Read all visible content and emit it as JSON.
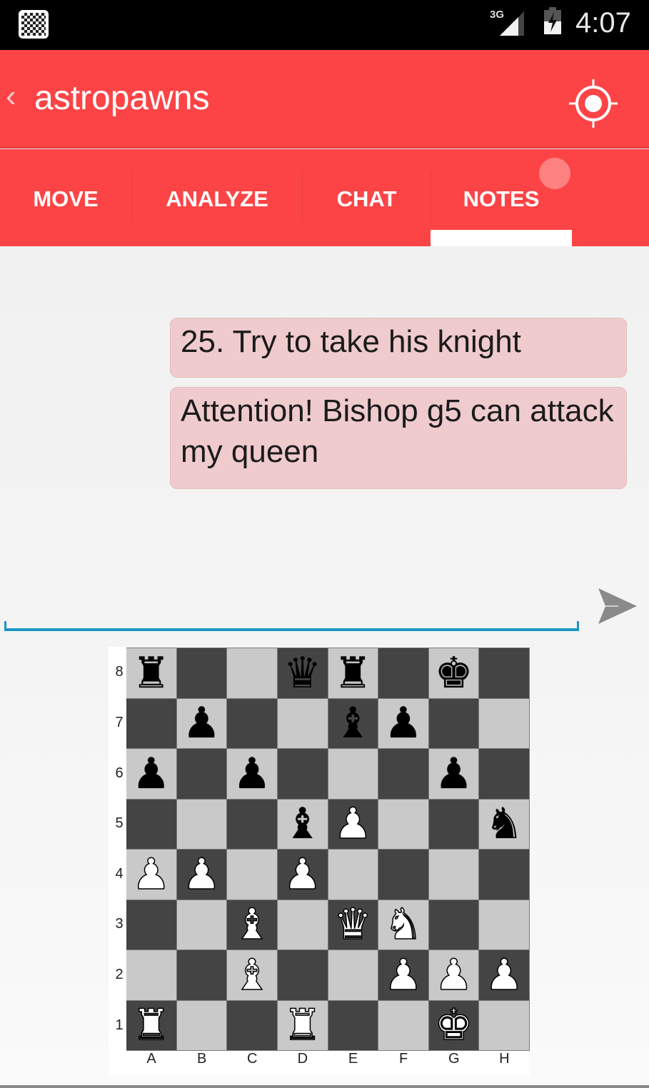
{
  "status_bar": {
    "app_icon": "chessboard-icon",
    "network": "3G",
    "signal_icon": "signal-icon",
    "battery_icon": "battery-charging-icon",
    "time": "4:07"
  },
  "app_bar": {
    "back_icon": "‹",
    "title": "astropawns",
    "action_icon": "target-icon",
    "color": "#fc4446"
  },
  "tabs": [
    {
      "label": "MOVE",
      "active": false
    },
    {
      "label": "ANALYZE",
      "active": false
    },
    {
      "label": "CHAT",
      "active": false
    },
    {
      "label": "NOTES",
      "active": true,
      "badge": true
    }
  ],
  "notes": [
    {
      "text": "25. Try to take his knight"
    },
    {
      "text": "Attention! Bishop g5 can attack my queen"
    }
  ],
  "note_input": {
    "value": "",
    "placeholder": "",
    "send_icon": "send-icon"
  },
  "board": {
    "ranks": [
      "8",
      "7",
      "6",
      "5",
      "4",
      "3",
      "2",
      "1"
    ],
    "files": [
      "A",
      "B",
      "C",
      "D",
      "E",
      "F",
      "G",
      "H"
    ],
    "rows": [
      [
        "r",
        "",
        "",
        "q",
        "r",
        "",
        "k",
        ""
      ],
      [
        "",
        "p",
        "",
        "",
        "b",
        "p",
        "",
        ""
      ],
      [
        "p",
        "",
        "p",
        "",
        "",
        "",
        "p",
        ""
      ],
      [
        "",
        "",
        "",
        "b",
        "P",
        "",
        "",
        "n"
      ],
      [
        "P",
        "P",
        "",
        "P",
        "",
        "",
        "",
        ""
      ],
      [
        "",
        "",
        "B",
        "",
        "Q",
        "N",
        "",
        ""
      ],
      [
        "",
        "",
        "B",
        "",
        "",
        "P",
        "P",
        "P"
      ],
      [
        "R",
        "",
        "",
        "R",
        "",
        "",
        "K",
        ""
      ]
    ],
    "light_color": "#c9c9c9",
    "dark_color": "#444444"
  }
}
